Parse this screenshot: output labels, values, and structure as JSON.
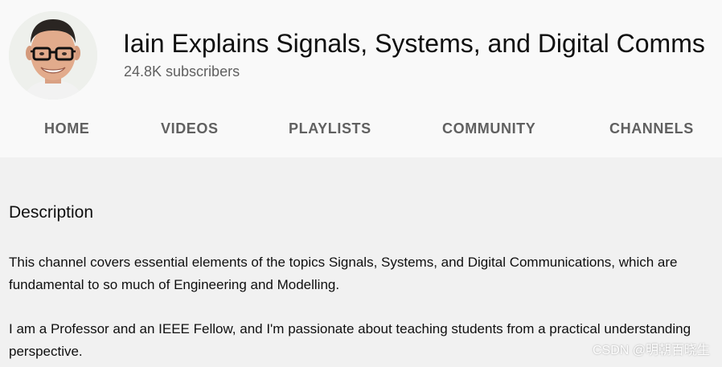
{
  "channel": {
    "title": "Iain Explains Signals, Systems, and Digital Comms",
    "subscribers": "24.8K subscribers"
  },
  "tabs": [
    {
      "label": "HOME"
    },
    {
      "label": "VIDEOS"
    },
    {
      "label": "PLAYLISTS"
    },
    {
      "label": "COMMUNITY"
    },
    {
      "label": "CHANNELS"
    }
  ],
  "about": {
    "heading": "Description",
    "paragraph_1": "This channel covers essential elements of the topics Signals, Systems, and Digital Communications, which are fundamental to so much of Engineering and Modelling.",
    "paragraph_2": "I am a Professor and an IEEE Fellow, and I'm passionate about teaching students from a practical understanding perspective."
  },
  "watermark": "CSDN @明朝百晓生",
  "colors": {
    "header_bg": "#f9f9f9",
    "page_bg": "#f1f1f1",
    "tab_text": "#606060",
    "secondary_text": "#606060"
  }
}
